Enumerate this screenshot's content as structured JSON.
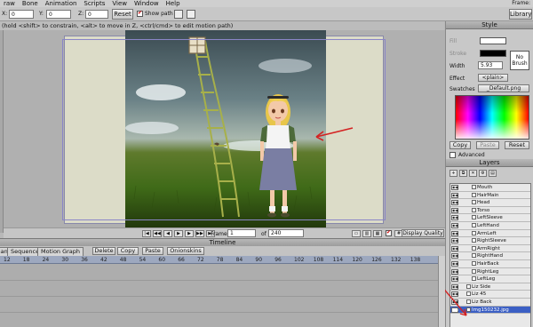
{
  "menu": [
    "raw",
    "Bone",
    "Animation",
    "Scripts",
    "View",
    "Window",
    "Help"
  ],
  "menu_right": "Frame:",
  "toolbar": {
    "x_label": "X:",
    "x_value": "0",
    "y_label": "Y:",
    "y_value": "0",
    "z_label": "Z:",
    "z_value": "0",
    "reset_label": "Reset",
    "show_path_label": "Show path",
    "library_label": "Library"
  },
  "hint_text": "(hold <shift> to constrain, <alt> to move in Z, <ctrl/cmd> to edit motion path)",
  "style_panel": {
    "title": "Style",
    "fill_label": "Fill",
    "stroke_label": "Stroke",
    "width_label": "Width",
    "width_value": "5.93",
    "effect_label": "Effect",
    "effect_value": "<plain>",
    "no_brush_line1": "No",
    "no_brush_line2": "Brush",
    "swatches_label": "Swatches",
    "swatches_value": "_Default.png",
    "copy_label": "Copy",
    "paste_label": "Paste",
    "reset_label": "Reset",
    "advanced_label": "Advanced",
    "fill_color": "#ffffff",
    "stroke_color": "#000000"
  },
  "layers_panel": {
    "title": "Layers",
    "rows": [
      {
        "name": "Mouth",
        "indent": true
      },
      {
        "name": "HairMain",
        "indent": true
      },
      {
        "name": "Head",
        "indent": true
      },
      {
        "name": "Torso",
        "indent": true
      },
      {
        "name": "LeftSleeve",
        "indent": true
      },
      {
        "name": "LeftHand",
        "indent": true
      },
      {
        "name": "ArmLeft",
        "indent": true
      },
      {
        "name": "RightSleeve",
        "indent": true
      },
      {
        "name": "ArmRight",
        "indent": true
      },
      {
        "name": "RightHand",
        "indent": true
      },
      {
        "name": "HairBack",
        "indent": true
      },
      {
        "name": "RightLeg",
        "indent": true
      },
      {
        "name": "LeftLeg",
        "indent": true
      },
      {
        "name": "Liz Side",
        "indent": false
      },
      {
        "name": "Liz 45",
        "indent": false
      },
      {
        "name": "Liz Back",
        "indent": false
      },
      {
        "name": "Img150232.jpg",
        "indent": false,
        "selected": true
      }
    ]
  },
  "control_bar": {
    "frame_label": "Frame",
    "frame_value": "1",
    "of_label": "of",
    "of_value": "240",
    "quality_label": "Display Quality"
  },
  "timeline": {
    "title": "Timeline",
    "tabs": [
      "Channels",
      "Sequencer",
      "Motion Graph"
    ],
    "delete_label": "Delete",
    "copy_label": "Copy",
    "paste_label": "Paste",
    "onionskins_label": "Onionskins",
    "ruler_ticks": [
      "12",
      "18",
      "24",
      "30",
      "36",
      "42",
      "48",
      "54",
      "60",
      "66",
      "72",
      "78",
      "84",
      "90",
      "96",
      "102",
      "108",
      "114",
      "120",
      "126",
      "132",
      "138"
    ]
  }
}
